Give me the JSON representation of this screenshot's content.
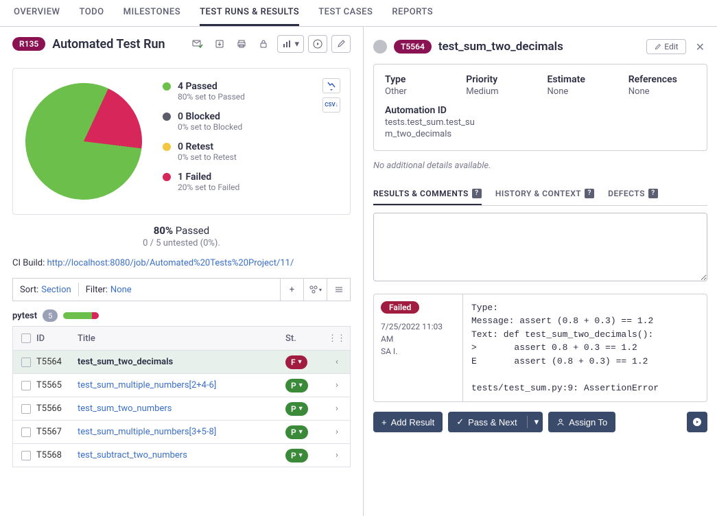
{
  "tabs": [
    "OVERVIEW",
    "TODO",
    "MILESTONES",
    "TEST RUNS & RESULTS",
    "TEST CASES",
    "REPORTS"
  ],
  "activeTab": 3,
  "run": {
    "badge": "R135",
    "title": "Automated Test Run"
  },
  "chart_data": {
    "type": "pie",
    "title": "",
    "categories": [
      "Passed",
      "Blocked",
      "Retest",
      "Failed"
    ],
    "values": [
      4,
      0,
      0,
      1
    ],
    "percentages": [
      80,
      0,
      0,
      20
    ],
    "colors": [
      "#6cbf4b",
      "#5a5c6b",
      "#f2c744",
      "#d7275a"
    ],
    "series_labels": [
      {
        "title": "4 Passed",
        "sub": "80% set to Passed"
      },
      {
        "title": "0 Blocked",
        "sub": "0% set to Blocked"
      },
      {
        "title": "0 Retest",
        "sub": "0% set to Retest"
      },
      {
        "title": "1 Failed",
        "sub": "20% set to Failed"
      }
    ]
  },
  "card_icons": {
    "chart": "📊",
    "csv": "CSV"
  },
  "percent": {
    "pct": "80%",
    "word": " Passed"
  },
  "untested": "0 / 5 untested (0%).",
  "ci": {
    "label": "CI Build: ",
    "url": "http://localhost:8080/job/Automated%20Tests%20Project/11/"
  },
  "filter": {
    "sortLabel": "Sort: ",
    "sortVal": "Section",
    "filterLabel": "Filter: ",
    "filterVal": "None"
  },
  "section": {
    "name": "pytest",
    "count": "5"
  },
  "tableHeader": {
    "id": "ID",
    "title": "Title",
    "st": "St."
  },
  "rows": [
    {
      "id": "T5564",
      "title": "test_sum_two_decimals",
      "status": "F",
      "selected": true
    },
    {
      "id": "T5565",
      "title": "test_sum_multiple_numbers[2+4-6]",
      "status": "P",
      "selected": false
    },
    {
      "id": "T5566",
      "title": "test_sum_two_numbers",
      "status": "P",
      "selected": false
    },
    {
      "id": "T5567",
      "title": "test_sum_multiple_numbers[3+5-8]",
      "status": "P",
      "selected": false
    },
    {
      "id": "T5568",
      "title": "test_subtract_two_numbers",
      "status": "P",
      "selected": false
    }
  ],
  "case": {
    "badge": "T5564",
    "title": "test_sum_two_decimals",
    "edit": "Edit",
    "meta": {
      "type": {
        "label": "Type",
        "val": "Other"
      },
      "priority": {
        "label": "Priority",
        "val": "Medium"
      },
      "estimate": {
        "label": "Estimate",
        "val": "None"
      },
      "references": {
        "label": "References",
        "val": "None"
      },
      "automation": {
        "label": "Automation ID",
        "val": "tests.test_sum.test_sum_two_decimals"
      }
    },
    "noDetails": "No additional details available.",
    "subTabs": [
      "RESULTS & COMMENTS",
      "HISTORY & CONTEXT",
      "DEFECTS"
    ],
    "activeSubTab": 0,
    "result": {
      "status": "Failed",
      "date": "7/25/2022 11:03 AM",
      "user": "SA I.",
      "body": "Type:\nMessage: assert (0.8 + 0.3) == 1.2\nText: def test_sum_two_decimals():\n>       assert 0.8 + 0.3 == 1.2\nE       assert (0.8 + 0.3) == 1.2\n\ntests/test_sum.py:9: AssertionError"
    },
    "actions": {
      "add": "Add Result",
      "pass": "Pass & Next",
      "assign": "Assign To"
    }
  }
}
